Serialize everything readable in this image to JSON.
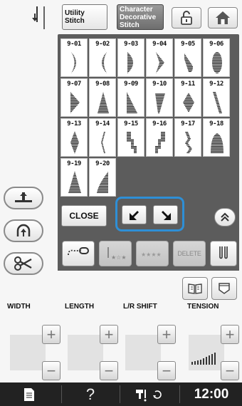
{
  "header": {
    "tab_utility": "Utility\nStitch",
    "tab_character": "Character\nDecorative\nStitch"
  },
  "stitches": [
    {
      "num": "9-01",
      "shape": "crescent-left"
    },
    {
      "num": "9-02",
      "shape": "crescent-right"
    },
    {
      "num": "9-03",
      "shape": "half-round"
    },
    {
      "num": "9-04",
      "shape": "arrow-right"
    },
    {
      "num": "9-05",
      "shape": "slant-drop"
    },
    {
      "num": "9-06",
      "shape": "oval"
    },
    {
      "num": "9-07",
      "shape": "triangle-right"
    },
    {
      "num": "9-08",
      "shape": "triangle-up"
    },
    {
      "num": "9-09",
      "shape": "right-triangle"
    },
    {
      "num": "9-10",
      "shape": "slant-bar"
    },
    {
      "num": "9-11",
      "shape": "diamond"
    },
    {
      "num": "9-12",
      "shape": "slant-thin"
    },
    {
      "num": "9-13",
      "shape": "diamond-long"
    },
    {
      "num": "9-14",
      "shape": "zigzag-thin"
    },
    {
      "num": "9-15",
      "shape": "steps-down"
    },
    {
      "num": "9-16",
      "shape": "steps-up"
    },
    {
      "num": "9-17",
      "shape": "zigzag-steps"
    },
    {
      "num": "9-18",
      "shape": "dome"
    },
    {
      "num": "9-19",
      "shape": "tall-triangle"
    },
    {
      "num": "9-20",
      "shape": "curve-triangle"
    }
  ],
  "panel": {
    "close_label": "CLOSE"
  },
  "edit": {
    "delete_label": "DELETE"
  },
  "settings": {
    "width_label": "WIDTH",
    "length_label": "LENGTH",
    "lr_shift_label": "L/R SHIFT",
    "tension_label": "TENSION",
    "plus": "+",
    "minus": "−"
  },
  "status": {
    "help_label": "?",
    "clock": "12:00"
  }
}
